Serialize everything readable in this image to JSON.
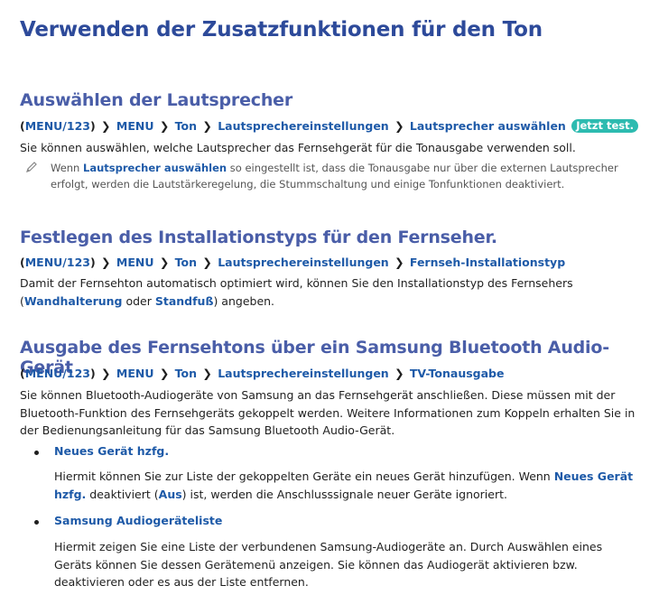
{
  "title": "Verwenden der Zusatzfunktionen für den Ton",
  "sections": [
    {
      "heading": "Auswählen der Lautsprecher",
      "path": {
        "menu123": "MENU/123",
        "menu": "MENU",
        "ton": "Ton",
        "sub": "Lautsprechereinstellungen",
        "leaf": "Lautsprecher auswählen",
        "try_now": "Jetzt test."
      },
      "text": "Sie können auswählen, welche Lautsprecher das Fernsehgerät für die Tonausgabe verwenden soll.",
      "note": {
        "prefix": "Wenn ",
        "keyword": "Lautsprecher auswählen",
        "suffix": " so eingestellt ist, dass die Tonausgabe nur über die externen Lautsprecher erfolgt, werden die Lautstärkeregelung, die Stummschaltung und einige Tonfunktionen deaktiviert."
      }
    },
    {
      "heading": "Festlegen des Installationstyps für den Fernseher.",
      "path": {
        "menu123": "MENU/123",
        "menu": "MENU",
        "ton": "Ton",
        "sub": "Lautsprechereinstellungen",
        "leaf": "Fernseh-Installationstyp"
      },
      "text": {
        "part1": "Damit der Fernsehton automatisch optimiert wird, können Sie den Installationstyp des Fernsehers (",
        "kw1": "Wandhalterung",
        "part2": " oder ",
        "kw2": "Standfuß",
        "part3": ") angeben."
      }
    },
    {
      "heading": "Ausgabe des Fernsehtons über ein Samsung Bluetooth Audio-Gerät",
      "path": {
        "menu123": "MENU/123",
        "menu": "MENU",
        "ton": "Ton",
        "sub": "Lautsprechereinstellungen",
        "leaf": "TV-Tonausgabe"
      },
      "text": "Sie können Bluetooth-Audiogeräte von Samsung an das Fernsehgerät anschließen. Diese müssen mit der Bluetooth-Funktion des Fernsehgeräts gekoppelt werden. Weitere Informationen zum Koppeln erhalten Sie in der Bedienungsanleitung für das Samsung Bluetooth Audio-Gerät.",
      "bullets": [
        {
          "label": "Neues Gerät hzfg.",
          "desc": {
            "part1": "Hiermit können Sie zur Liste der gekoppelten Geräte ein neues Gerät hinzufügen. Wenn ",
            "kw1": "Neues Gerät hzfg.",
            "part2": " deaktiviert (",
            "kw2": "Aus",
            "part3": ") ist, werden die Anschlusssignale neuer Geräte ignoriert."
          }
        },
        {
          "label": "Samsung Audiogeräteliste",
          "desc": "Hiermit zeigen Sie eine Liste der verbundenen Samsung-Audiogeräte an. Durch Auswählen eines Geräts können Sie dessen Gerätemenü anzeigen. Sie können das Audiogerät aktivieren bzw. deaktivieren oder es aus der Liste entfernen."
        }
      ]
    }
  ],
  "icons": {
    "note": "pencil-icon",
    "path_separator": "chevron-right-icon"
  },
  "colors": {
    "heading": "#2d4a9a",
    "subheading": "#4a5ea8",
    "keyword": "#1e5aa8",
    "badge": "#2dbbb0"
  }
}
